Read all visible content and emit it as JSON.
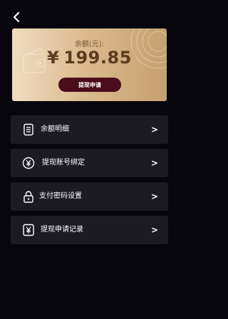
{
  "balance_card": {
    "label": "余额(元):",
    "currency_symbol": "¥",
    "amount": "199.85",
    "apply_button": "提现申请"
  },
  "menu": {
    "items": [
      {
        "label": "余额明细",
        "icon": "list-icon",
        "chevron": ">"
      },
      {
        "label": "提现账号绑定",
        "icon": "yen-circle-icon",
        "chevron": ">"
      },
      {
        "label": "支付密码设置",
        "icon": "lock-icon",
        "chevron": ">"
      },
      {
        "label": "提现申请记录",
        "icon": "yen-square-icon",
        "chevron": ">"
      }
    ]
  },
  "colors": {
    "background": "#07060c",
    "card_gradient_start": "#f0dcc0",
    "card_gradient_end": "#c5a070",
    "amount_text": "#5a3d1e",
    "apply_button": "#4b0c1c",
    "menu_item_bg": "#1c1b24"
  }
}
